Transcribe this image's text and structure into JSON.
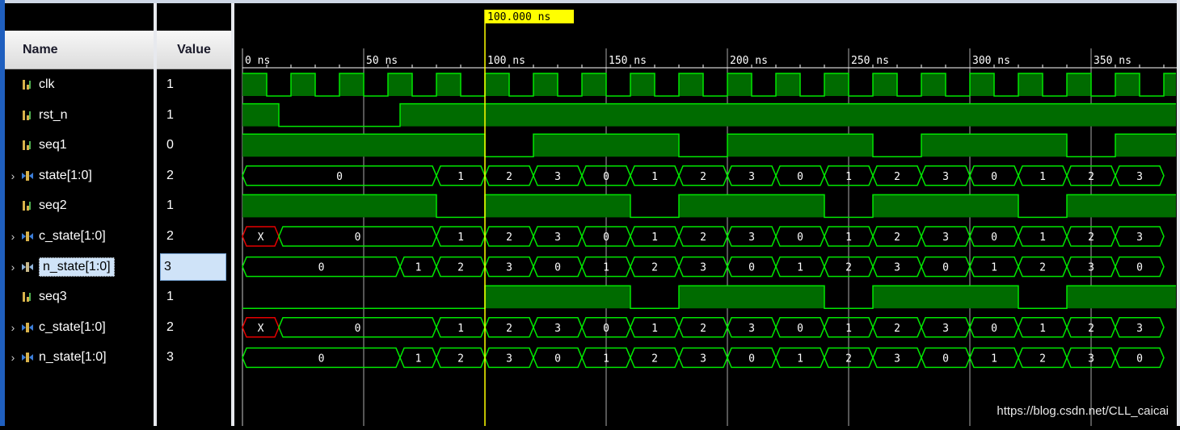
{
  "headers": {
    "name": "Name",
    "value": "Value"
  },
  "cursor": {
    "label": "100.000 ns",
    "time": 100
  },
  "time_axis": {
    "ticks": [
      0,
      50,
      100,
      150,
      200,
      250,
      300,
      350
    ],
    "unit": "ns",
    "end": 385
  },
  "signals": [
    {
      "name": "clk",
      "value": "1",
      "type": "bit",
      "icon": "bit-signal-icon",
      "expandable": false,
      "edges": [
        [
          0,
          1
        ],
        [
          10,
          0
        ],
        [
          20,
          1
        ],
        [
          30,
          0
        ],
        [
          40,
          1
        ],
        [
          50,
          0
        ],
        [
          60,
          1
        ],
        [
          70,
          0
        ],
        [
          80,
          1
        ],
        [
          90,
          0
        ],
        [
          100,
          1
        ],
        [
          110,
          0
        ],
        [
          120,
          1
        ],
        [
          130,
          0
        ],
        [
          140,
          1
        ],
        [
          150,
          0
        ],
        [
          160,
          1
        ],
        [
          170,
          0
        ],
        [
          180,
          1
        ],
        [
          190,
          0
        ],
        [
          200,
          1
        ],
        [
          210,
          0
        ],
        [
          220,
          1
        ],
        [
          230,
          0
        ],
        [
          240,
          1
        ],
        [
          250,
          0
        ],
        [
          260,
          1
        ],
        [
          270,
          0
        ],
        [
          280,
          1
        ],
        [
          290,
          0
        ],
        [
          300,
          1
        ],
        [
          310,
          0
        ],
        [
          320,
          1
        ],
        [
          330,
          0
        ],
        [
          340,
          1
        ],
        [
          350,
          0
        ],
        [
          360,
          1
        ],
        [
          370,
          0
        ],
        [
          380,
          1
        ]
      ]
    },
    {
      "name": "rst_n",
      "value": "1",
      "type": "bit",
      "icon": "bit-signal-icon",
      "expandable": false,
      "edges": [
        [
          0,
          1
        ],
        [
          15,
          0
        ],
        [
          65,
          1
        ]
      ]
    },
    {
      "name": "seq1",
      "value": "0",
      "type": "bit",
      "icon": "bit-signal-icon",
      "expandable": false,
      "edges": [
        [
          0,
          1
        ],
        [
          100,
          0
        ],
        [
          120,
          1
        ],
        [
          180,
          0
        ],
        [
          200,
          1
        ],
        [
          260,
          0
        ],
        [
          280,
          1
        ],
        [
          340,
          0
        ],
        [
          360,
          1
        ]
      ]
    },
    {
      "name": "state[1:0]",
      "value": "2",
      "type": "bus",
      "icon": "bus-signal-icon",
      "expandable": true,
      "segments": [
        [
          0,
          80,
          "0"
        ],
        [
          80,
          100,
          "1"
        ],
        [
          100,
          120,
          "2"
        ],
        [
          120,
          140,
          "3"
        ],
        [
          140,
          160,
          "0"
        ],
        [
          160,
          180,
          "1"
        ],
        [
          180,
          200,
          "2"
        ],
        [
          200,
          220,
          "3"
        ],
        [
          220,
          240,
          "0"
        ],
        [
          240,
          260,
          "1"
        ],
        [
          260,
          280,
          "2"
        ],
        [
          280,
          300,
          "3"
        ],
        [
          300,
          320,
          "0"
        ],
        [
          320,
          340,
          "1"
        ],
        [
          340,
          360,
          "2"
        ],
        [
          360,
          380,
          "3"
        ]
      ]
    },
    {
      "name": "seq2",
      "value": "1",
      "type": "bit",
      "icon": "bit-signal-icon",
      "expandable": false,
      "edges": [
        [
          0,
          1
        ],
        [
          80,
          0
        ],
        [
          100,
          1
        ],
        [
          160,
          0
        ],
        [
          180,
          1
        ],
        [
          240,
          0
        ],
        [
          260,
          1
        ],
        [
          320,
          0
        ],
        [
          340,
          1
        ]
      ]
    },
    {
      "name": "c_state[1:0]",
      "value": "2",
      "type": "bus",
      "icon": "bus-signal-icon",
      "expandable": true,
      "segments": [
        [
          0,
          15,
          "X"
        ],
        [
          15,
          80,
          "0"
        ],
        [
          80,
          100,
          "1"
        ],
        [
          100,
          120,
          "2"
        ],
        [
          120,
          140,
          "3"
        ],
        [
          140,
          160,
          "0"
        ],
        [
          160,
          180,
          "1"
        ],
        [
          180,
          200,
          "2"
        ],
        [
          200,
          220,
          "3"
        ],
        [
          220,
          240,
          "0"
        ],
        [
          240,
          260,
          "1"
        ],
        [
          260,
          280,
          "2"
        ],
        [
          280,
          300,
          "3"
        ],
        [
          300,
          320,
          "0"
        ],
        [
          320,
          340,
          "1"
        ],
        [
          340,
          360,
          "2"
        ],
        [
          360,
          380,
          "3"
        ]
      ]
    },
    {
      "name": "n_state[1:0]",
      "value": "3",
      "type": "bus",
      "icon": "bus-signal-icon-selected",
      "expandable": true,
      "selected": true,
      "segments": [
        [
          0,
          65,
          "0"
        ],
        [
          65,
          80,
          "1"
        ],
        [
          80,
          100,
          "2"
        ],
        [
          100,
          120,
          "3"
        ],
        [
          120,
          140,
          "0"
        ],
        [
          140,
          160,
          "1"
        ],
        [
          160,
          180,
          "2"
        ],
        [
          180,
          200,
          "3"
        ],
        [
          200,
          220,
          "0"
        ],
        [
          220,
          240,
          "1"
        ],
        [
          240,
          260,
          "2"
        ],
        [
          260,
          280,
          "3"
        ],
        [
          280,
          300,
          "0"
        ],
        [
          300,
          320,
          "1"
        ],
        [
          320,
          340,
          "2"
        ],
        [
          340,
          360,
          "3"
        ],
        [
          360,
          380,
          "0"
        ]
      ]
    },
    {
      "name": "seq3",
      "value": "1",
      "type": "bit",
      "icon": "bit-signal-icon",
      "expandable": false,
      "edges": [
        [
          0,
          0
        ],
        [
          100,
          1
        ],
        [
          160,
          0
        ],
        [
          180,
          1
        ],
        [
          240,
          0
        ],
        [
          260,
          1
        ],
        [
          320,
          0
        ],
        [
          340,
          1
        ]
      ]
    },
    {
      "name": "c_state[1:0]",
      "value": "2",
      "type": "bus",
      "icon": "bus-signal-icon",
      "expandable": true,
      "segments": [
        [
          0,
          15,
          "X"
        ],
        [
          15,
          80,
          "0"
        ],
        [
          80,
          100,
          "1"
        ],
        [
          100,
          120,
          "2"
        ],
        [
          120,
          140,
          "3"
        ],
        [
          140,
          160,
          "0"
        ],
        [
          160,
          180,
          "1"
        ],
        [
          180,
          200,
          "2"
        ],
        [
          200,
          220,
          "3"
        ],
        [
          220,
          240,
          "0"
        ],
        [
          240,
          260,
          "1"
        ],
        [
          260,
          280,
          "2"
        ],
        [
          280,
          300,
          "3"
        ],
        [
          300,
          320,
          "0"
        ],
        [
          320,
          340,
          "1"
        ],
        [
          340,
          360,
          "2"
        ],
        [
          360,
          380,
          "3"
        ]
      ]
    },
    {
      "name": "n_state[1:0]",
      "value": "3",
      "type": "bus",
      "icon": "bus-signal-icon",
      "expandable": true,
      "segments": [
        [
          0,
          65,
          "0"
        ],
        [
          65,
          80,
          "1"
        ],
        [
          80,
          100,
          "2"
        ],
        [
          100,
          120,
          "3"
        ],
        [
          120,
          140,
          "0"
        ],
        [
          140,
          160,
          "1"
        ],
        [
          160,
          180,
          "2"
        ],
        [
          180,
          200,
          "3"
        ],
        [
          200,
          220,
          "0"
        ],
        [
          220,
          240,
          "1"
        ],
        [
          240,
          260,
          "2"
        ],
        [
          260,
          280,
          "3"
        ],
        [
          280,
          300,
          "0"
        ],
        [
          300,
          320,
          "1"
        ],
        [
          320,
          340,
          "2"
        ],
        [
          340,
          360,
          "3"
        ],
        [
          360,
          380,
          "0"
        ]
      ]
    }
  ],
  "colors": {
    "wave": "#00e600",
    "fill": "#006b00",
    "x_state": "#e60000",
    "cursor": "#ffff00",
    "grid": "#c8c8c8"
  },
  "watermark": "https://blog.csdn.net/CLL_caicai"
}
